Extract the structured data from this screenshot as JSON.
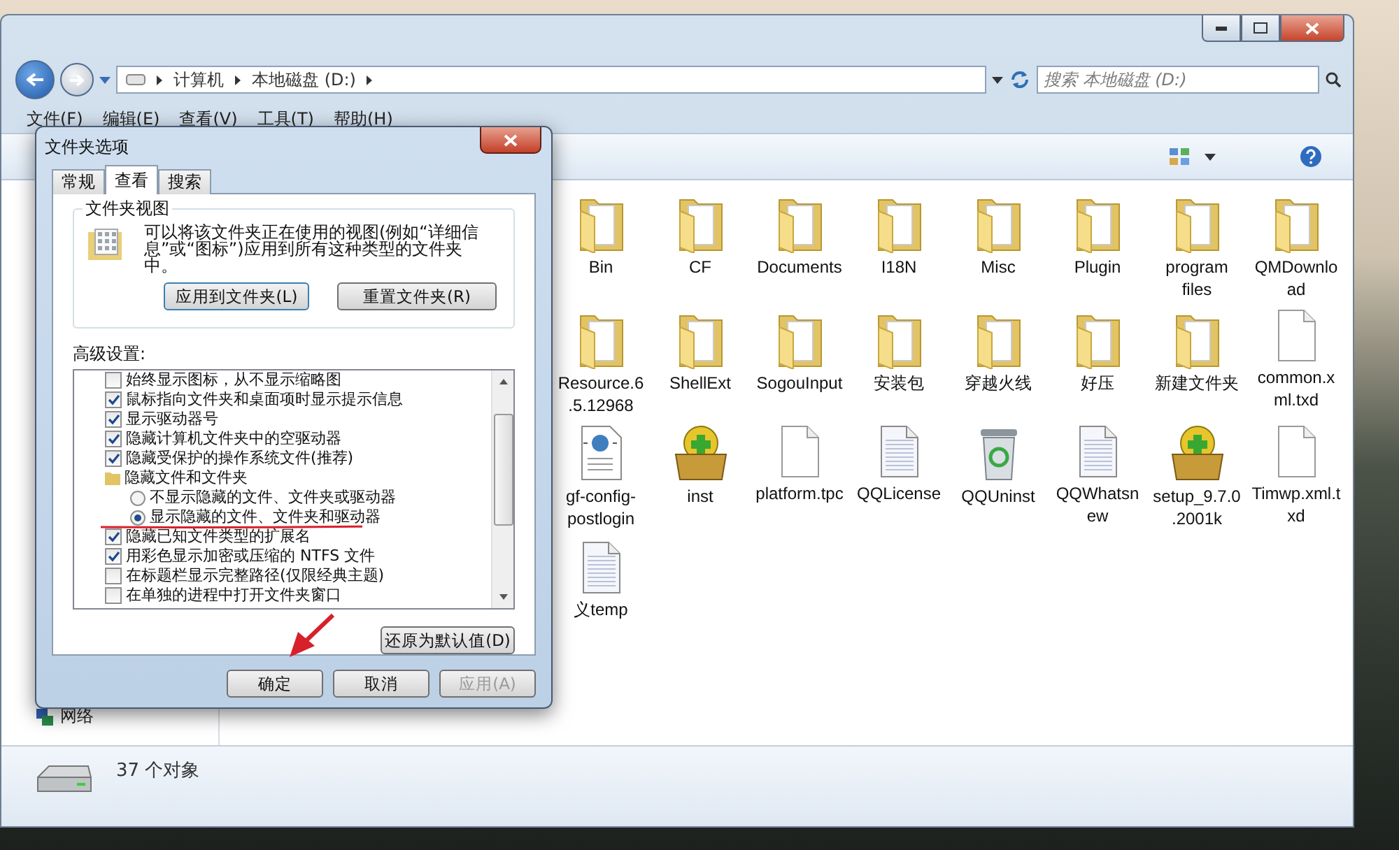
{
  "explorer": {
    "breadcrumb": [
      "计算机",
      "本地磁盘 (D:)"
    ],
    "search": {
      "placeholder": "搜索 本地磁盘 (D:)"
    },
    "menu": [
      "文件(F)",
      "编辑(E)",
      "查看(V)",
      "工具(T)",
      "帮助(H)"
    ],
    "nav_items": [
      {
        "label": "网络"
      }
    ],
    "files": [
      {
        "name": "Bin",
        "kind": "folder"
      },
      {
        "name": "CF",
        "kind": "folder"
      },
      {
        "name": "Documents",
        "kind": "folder"
      },
      {
        "name": "I18N",
        "kind": "folder"
      },
      {
        "name": "Misc",
        "kind": "folder"
      },
      {
        "name": "Plugin",
        "kind": "folder"
      },
      {
        "name": "program files",
        "kind": "folder"
      },
      {
        "name": "QMDownload",
        "kind": "folder"
      },
      {
        "name": "Resource.6.5.12968",
        "kind": "folder"
      },
      {
        "name": "ShellExt",
        "kind": "folder"
      },
      {
        "name": "SogouInput",
        "kind": "folder"
      },
      {
        "name": "安装包",
        "kind": "folder"
      },
      {
        "name": "穿越火线",
        "kind": "folder"
      },
      {
        "name": "好压",
        "kind": "folder"
      },
      {
        "name": "新建文件夹",
        "kind": "folder"
      },
      {
        "name": "common.xml.txd",
        "kind": "blank"
      },
      {
        "name": "gf-config-postlogin",
        "kind": "web"
      },
      {
        "name": "inst",
        "kind": "package"
      },
      {
        "name": "platform.tpc",
        "kind": "blank"
      },
      {
        "name": "QQLicense",
        "kind": "lined"
      },
      {
        "name": "QQUninst",
        "kind": "bin"
      },
      {
        "name": "QQWhatsnew",
        "kind": "lined"
      },
      {
        "name": "setup_9.7.0.2001k",
        "kind": "package"
      },
      {
        "name": "Timwp.xml.txd",
        "kind": "blank"
      },
      {
        "name": "义temp",
        "kind": "lined"
      }
    ],
    "status": "37 个对象"
  },
  "dialog": {
    "title": "文件夹选项",
    "tabs": [
      {
        "label": "常规",
        "selected": false
      },
      {
        "label": "查看",
        "selected": true
      },
      {
        "label": "搜索",
        "selected": false
      }
    ],
    "folder_view": {
      "title": "文件夹视图",
      "description": "可以将该文件夹正在使用的视图(例如“详细信息”或“图标”)应用到所有这种类型的文件夹中。",
      "buttons": [
        "应用到文件夹(L)",
        "重置文件夹(R)"
      ]
    },
    "advanced_label": "高级设置:",
    "settings": [
      {
        "kind": "checkbox",
        "label": "始终显示图标，从不显示缩略图",
        "checked": false
      },
      {
        "kind": "checkbox",
        "label": "鼠标指向文件夹和桌面项时显示提示信息",
        "checked": true
      },
      {
        "kind": "checkbox",
        "label": "显示驱动器号",
        "checked": true
      },
      {
        "kind": "checkbox",
        "label": "隐藏计算机文件夹中的空驱动器",
        "checked": true
      },
      {
        "kind": "checkbox",
        "label": "隐藏受保护的操作系统文件(推荐)",
        "checked": true
      },
      {
        "kind": "folder",
        "label": "隐藏文件和文件夹",
        "children": [
          {
            "kind": "radio",
            "label": "不显示隐藏的文件、文件夹或驱动器",
            "selected": false
          },
          {
            "kind": "radio",
            "label": "显示隐藏的文件、文件夹和驱动器",
            "selected": true
          }
        ]
      },
      {
        "kind": "checkbox",
        "label": "隐藏已知文件类型的扩展名",
        "checked": true
      },
      {
        "kind": "checkbox",
        "label": "用彩色显示加密或压缩的 NTFS 文件",
        "checked": true
      },
      {
        "kind": "checkbox",
        "label": "在标题栏显示完整路径(仅限经典主题)",
        "checked": false
      },
      {
        "kind": "checkbox",
        "label": "在单独的进程中打开文件夹窗口",
        "checked": false
      }
    ],
    "restore_button": "还原为默认值(D)",
    "buttons": [
      {
        "label": "确定",
        "disabled": false
      },
      {
        "label": "取消",
        "disabled": false
      },
      {
        "label": "应用(A)",
        "disabled": true
      }
    ]
  }
}
